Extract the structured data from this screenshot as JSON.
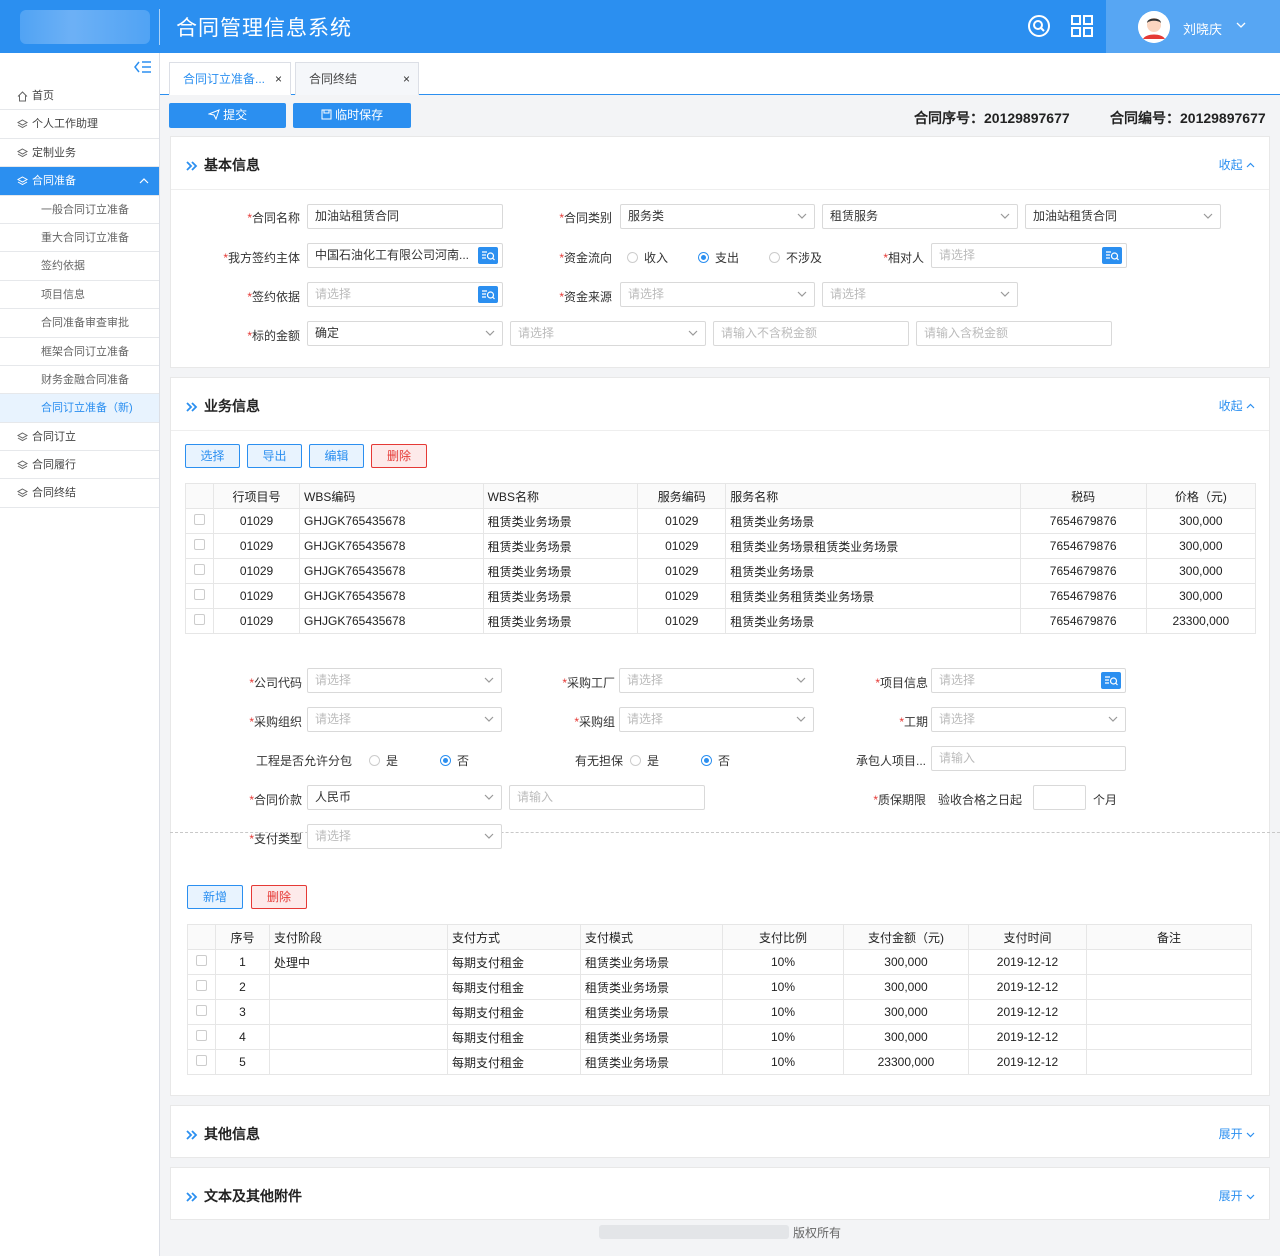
{
  "header": {
    "title": "合同管理信息系统",
    "user": "刘晓庆"
  },
  "sidebar": {
    "items": [
      {
        "label": "首页",
        "level": 1,
        "icon": "home-icon"
      },
      {
        "label": "个人工作助理",
        "level": 1,
        "icon": "layers-icon"
      },
      {
        "label": "定制业务",
        "level": 1,
        "icon": "layers-icon"
      },
      {
        "label": "合同准备",
        "level": 1,
        "icon": "layers-icon",
        "active": true
      },
      {
        "label": "一般合同订立准备",
        "level": 2
      },
      {
        "label": "重大合同订立准备",
        "level": 2
      },
      {
        "label": "签约依据",
        "level": 2
      },
      {
        "label": "项目信息",
        "level": 2
      },
      {
        "label": "合同准备审查审批",
        "level": 2
      },
      {
        "label": "框架合同订立准备",
        "level": 2
      },
      {
        "label": "财务金融合同准备",
        "level": 2
      },
      {
        "label": "合同订立准备（新)",
        "level": 2,
        "selected": true
      },
      {
        "label": "合同订立",
        "level": 1,
        "icon": "layers-icon"
      },
      {
        "label": "合同履行",
        "level": 1,
        "icon": "layers-icon"
      },
      {
        "label": "合同终结",
        "level": 1,
        "icon": "layers-icon"
      }
    ]
  },
  "tabs": [
    {
      "label": "合同订立准备...",
      "active": true
    },
    {
      "label": "合同终结",
      "active": false
    }
  ],
  "toolbar": {
    "submit": "提交",
    "save": "临时保存",
    "seq_label": "合同序号：",
    "seq_value": "20129897677",
    "no_label": "合同编号：",
    "no_value": "20129897677"
  },
  "basic": {
    "title": "基本信息",
    "toggle": "收起",
    "name_label": "合同名称",
    "name_value": "加油站租赁合同",
    "type_label": "合同类别",
    "type1": "服务类",
    "type2": "租赁服务",
    "type3": "加油站租赁合同",
    "party_label": "我方签约主体",
    "party_value": "中国石油化工有限公司河南...",
    "flow_label": "资金流向",
    "flow_opts": [
      "收入",
      "支出",
      "不涉及"
    ],
    "counter_label": "相对人",
    "counter_ph": "请选择",
    "basis_label": "签约依据",
    "basis_ph": "请选择",
    "source_label": "资金来源",
    "source_ph1": "请选择",
    "source_ph2": "请选择",
    "amount_label": "标的金额",
    "amount_value": "确定",
    "amount_ph1": "请选择",
    "amount_ph2": "请输入不含税金额",
    "amount_ph3": "请输入含税金额"
  },
  "business": {
    "title": "业务信息",
    "toggle": "收起",
    "buttons": {
      "select": "选择",
      "export": "导出",
      "edit": "编辑",
      "delete": "删除"
    },
    "columns": [
      "行项目号",
      "WBS编码",
      "WBS名称",
      "服务编码",
      "服务名称",
      "税码",
      "价格（元)"
    ],
    "rows": [
      [
        "01029",
        "GHJGK765435678",
        "租赁类业务场景",
        "01029",
        "租赁类业务场景",
        "7654679876",
        "300,000"
      ],
      [
        "01029",
        "GHJGK765435678",
        "租赁类业务场景",
        "01029",
        "租赁类业务场景租赁类业务场景",
        "7654679876",
        "300,000"
      ],
      [
        "01029",
        "GHJGK765435678",
        "租赁类业务场景",
        "01029",
        "租赁类业务场景",
        "7654679876",
        "300,000"
      ],
      [
        "01029",
        "GHJGK765435678",
        "租赁类业务场景",
        "01029",
        "租赁类业务租赁类业务场景",
        "7654679876",
        "300,000"
      ],
      [
        "01029",
        "GHJGK765435678",
        "租赁类业务场景",
        "01029",
        "租赁类业务场景",
        "7654679876",
        "23300,000"
      ]
    ],
    "company_label": "公司代码",
    "company_ph": "请选择",
    "factory_label": "采购工厂",
    "factory_ph": "请选择",
    "project_label": "项目信息",
    "project_ph": "请选择",
    "org_label": "采购组织",
    "org_ph": "请选择",
    "group_label": "采购组",
    "group_ph": "请选择",
    "period_label": "工期",
    "period_ph": "请选择",
    "sub_label": "工程是否允许分包",
    "sub_opts": [
      "是",
      "否"
    ],
    "guar_label": "有无担保",
    "guar_opts": [
      "是",
      "否"
    ],
    "contractor_label": "承包人项目...",
    "contractor_ph": "请输入",
    "price_label": "合同价款",
    "currency": "人民币",
    "price_ph": "请输入",
    "warranty_label": "质保期限",
    "warranty_text": "验收合格之日起",
    "warranty_unit": "个月",
    "paytype_label": "支付类型",
    "paytype_ph": "请选择",
    "pay_buttons": {
      "add": "新增",
      "delete": "删除"
    },
    "pay_columns": [
      "序号",
      "支付阶段",
      "支付方式",
      "支付模式",
      "支付比例",
      "支付金额（元)",
      "支付时间",
      "备注"
    ],
    "pay_rows": [
      [
        "1",
        "处理中",
        "每期支付租金",
        "租赁类业务场景",
        "10%",
        "300,000",
        "2019-12-12",
        ""
      ],
      [
        "2",
        "",
        "每期支付租金",
        "租赁类业务场景",
        "10%",
        "300,000",
        "2019-12-12",
        ""
      ],
      [
        "3",
        "",
        "每期支付租金",
        "租赁类业务场景",
        "10%",
        "300,000",
        "2019-12-12",
        ""
      ],
      [
        "4",
        "",
        "每期支付租金",
        "租赁类业务场景",
        "10%",
        "300,000",
        "2019-12-12",
        ""
      ],
      [
        "5",
        "",
        "每期支付租金",
        "租赁类业务场景",
        "10%",
        "23300,000",
        "2019-12-12",
        ""
      ]
    ]
  },
  "other": {
    "title": "其他信息",
    "toggle": "展开"
  },
  "attach": {
    "title": "文本及其他附件",
    "toggle": "展开"
  },
  "footer": {
    "text": "版权所有"
  }
}
